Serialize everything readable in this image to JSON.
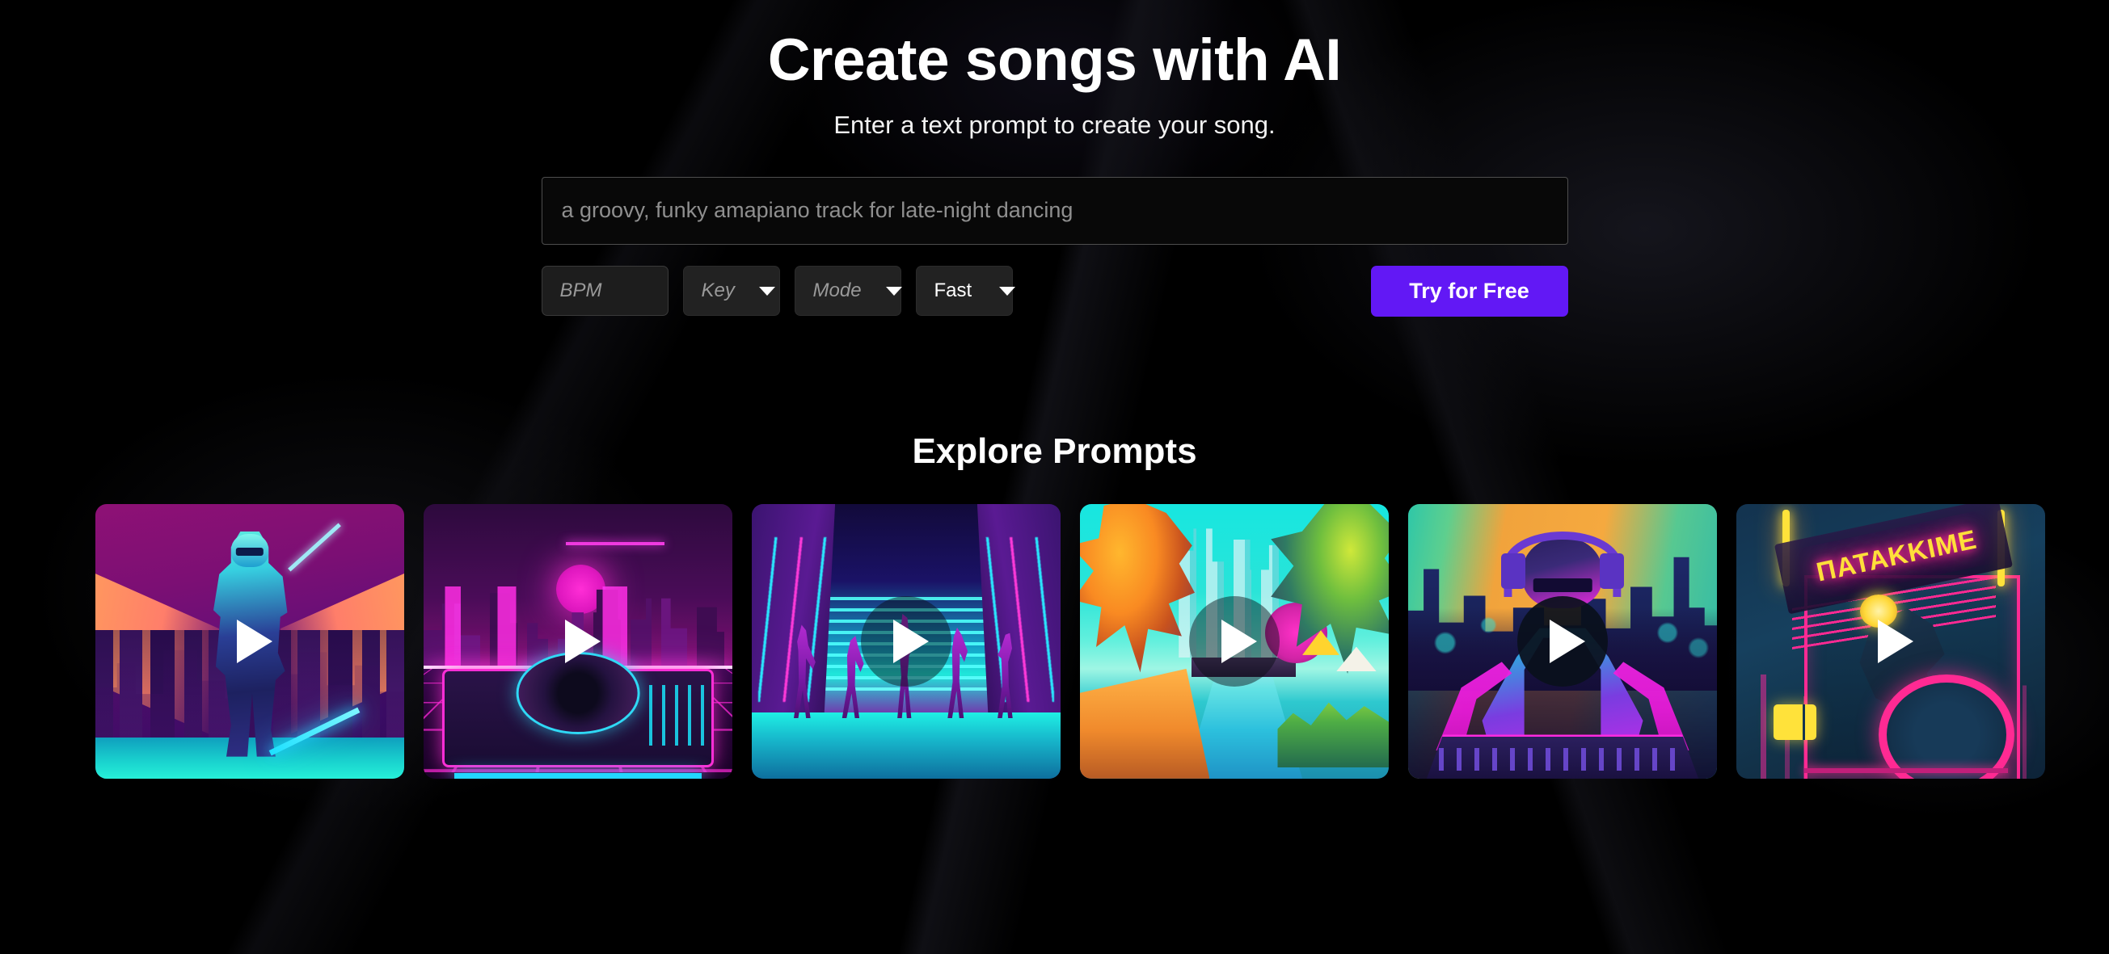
{
  "hero": {
    "title": "Create songs with AI",
    "subtitle": "Enter a text prompt to create your song."
  },
  "form": {
    "prompt": {
      "value": "",
      "placeholder": "a groovy, funky amapiano track for late-night dancing"
    },
    "bpm": {
      "label": "BPM",
      "value": "",
      "placeholder": "BPM"
    },
    "key": {
      "label": "Key",
      "selected": "Key",
      "is_placeholder": true
    },
    "mode": {
      "label": "Mode",
      "selected": "Mode",
      "is_placeholder": true
    },
    "speed": {
      "label": "Fast",
      "selected": "Fast",
      "is_placeholder": false
    },
    "cta": {
      "label": "Try for Free"
    }
  },
  "explore": {
    "title": "Explore Prompts",
    "play_icon": "play-icon",
    "cards": [
      {
        "id": "card-neon-knight",
        "alt": "Neon cyberpunk armored knight with glowing sword in a purple city at sunset",
        "play_style": "none"
      },
      {
        "id": "card-synthwave-turntable",
        "alt": "Synthwave turntable DJ deck with magenta sun and neon city skyline",
        "play_style": "none"
      },
      {
        "id": "card-neon-dancers",
        "alt": "Five dancers silhouetted against a cyan neon street horizon",
        "play_style": "scrim"
      },
      {
        "id": "card-tropical-canal",
        "alt": "Vibrant tropical canal with palm trees, umbrellas and teal sky",
        "play_style": "scrim"
      },
      {
        "id": "card-dj-headphones",
        "alt": "DJ with headphones at a mixer in front of an orange and teal city skyline",
        "play_style": "solid"
      },
      {
        "id": "card-neon-sign-drum",
        "alt": "Neon shop sign with pink drum kit and yellow light tubes",
        "play_style": "none",
        "sign_text": "ΠΑΤΑΚΚΙΜΕ"
      }
    ]
  },
  "colors": {
    "background": "#000000",
    "accent": "#6218f5",
    "text": "#ffffff",
    "placeholder": "#8f8f8f",
    "control_fill": "#222222",
    "input_border": "#4e4e4e"
  }
}
